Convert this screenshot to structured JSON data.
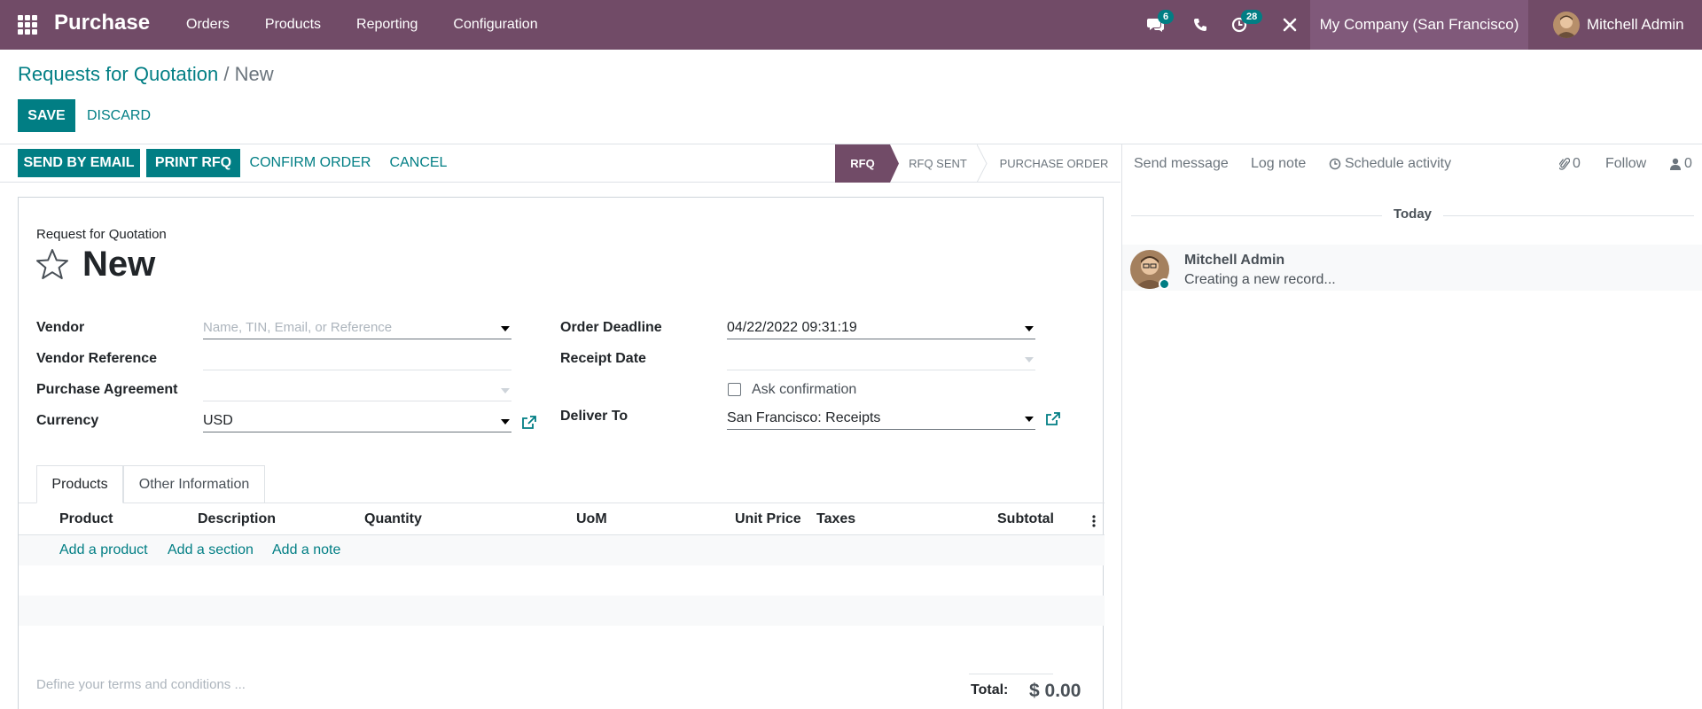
{
  "nav": {
    "brand": "Purchase",
    "menu": [
      "Orders",
      "Products",
      "Reporting",
      "Configuration"
    ],
    "chat_count": "6",
    "activity_count": "28",
    "company": "My Company (San Francisco)",
    "user": "Mitchell Admin"
  },
  "breadcrumb": {
    "parent": "Requests for Quotation",
    "separator": "/",
    "current": "New"
  },
  "actions": {
    "save": "SAVE",
    "discard": "DISCARD"
  },
  "statusbar": {
    "buttons": [
      "SEND BY EMAIL",
      "PRINT RFQ",
      "CONFIRM ORDER",
      "CANCEL"
    ],
    "stages": [
      "RFQ",
      "RFQ SENT",
      "PURCHASE ORDER"
    ],
    "active_stage": "RFQ"
  },
  "form": {
    "subtitle": "Request for Quotation",
    "title": "New",
    "vendor_label": "Vendor",
    "vendor_placeholder": "Name, TIN, Email, or Reference",
    "vendor_ref_label": "Vendor Reference",
    "agreement_label": "Purchase Agreement",
    "currency_label": "Currency",
    "currency_value": "USD",
    "deadline_label": "Order Deadline",
    "deadline_value": "04/22/2022 09:31:19",
    "receipt_label": "Receipt Date",
    "ask_confirmation_label": "Ask confirmation",
    "ask_confirmation_checked": false,
    "deliver_label": "Deliver To",
    "deliver_value": "San Francisco: Receipts"
  },
  "tabs": [
    "Products",
    "Other Information"
  ],
  "table": {
    "columns": [
      "Product",
      "Description",
      "Quantity",
      "UoM",
      "Unit Price",
      "Taxes",
      "Subtotal"
    ],
    "add_links": [
      "Add a product",
      "Add a section",
      "Add a note"
    ]
  },
  "footer": {
    "terms_placeholder": "Define your terms and conditions ...",
    "total_label": "Total:",
    "total_value": "$ 0.00"
  },
  "chatter": {
    "send_message": "Send message",
    "log_note": "Log note",
    "schedule_activity": "Schedule activity",
    "attachments": "0",
    "follow": "Follow",
    "followers": "0",
    "date_separator": "Today",
    "messages": [
      {
        "author": "Mitchell Admin",
        "body": "Creating a new record..."
      }
    ]
  },
  "colors": {
    "navbar": "#714B67",
    "primary": "#017E84"
  }
}
